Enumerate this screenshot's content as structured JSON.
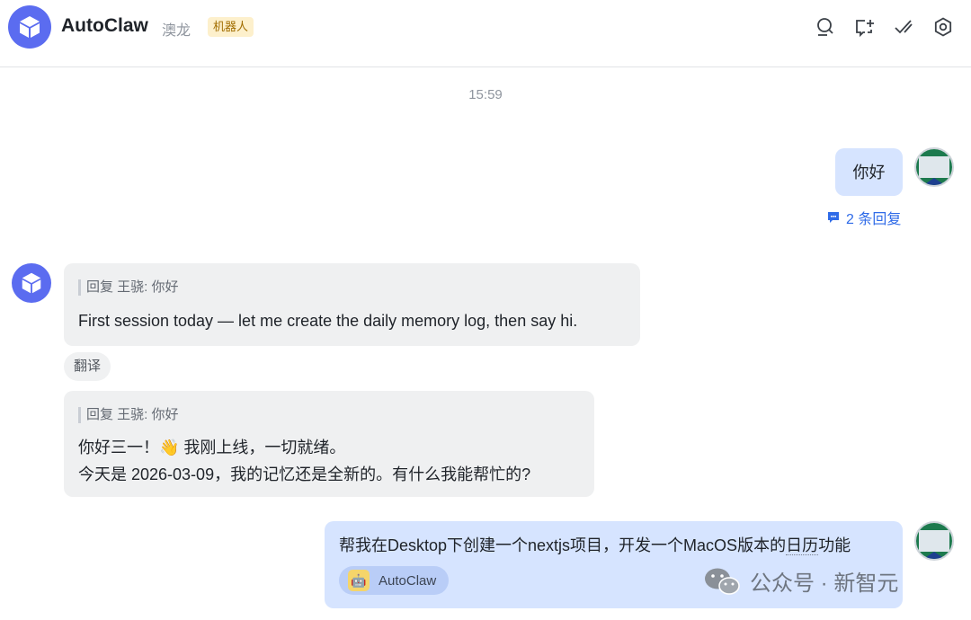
{
  "header": {
    "title": "AutoClaw",
    "subtitle": "澳龙",
    "badge": "机器人",
    "icons": [
      "search-chat-icon",
      "new-chat-icon",
      "check-icon",
      "settings-icon"
    ]
  },
  "chat": {
    "timestamp": "15:59",
    "messages": [
      {
        "role": "user",
        "text": "你好",
        "thread_link": "2 条回复"
      },
      {
        "role": "bot",
        "reply_quote": "回复 王骁: 你好",
        "text": "First session today — let me create the daily memory log, then say hi.",
        "action": "翻译"
      },
      {
        "role": "bot",
        "reply_quote": "回复 王骁: 你好",
        "lines": [
          "你好三一！👋 我刚上线，一切就绪。",
          "今天是 2026-03-09，我的记忆还是全新的。有什么我能帮忙的?"
        ]
      },
      {
        "role": "user",
        "text_before": "帮我在Desktop下创建一个nextjs项目，开发一个MacOS版本的",
        "text_dotted": "日历",
        "text_after": "功能",
        "mention_emoji": "🤖",
        "mention": "AutoClaw"
      }
    ]
  },
  "watermark": "公众号 · 新智元",
  "colors": {
    "accent": "#5b6cf0",
    "user_bubble": "#d6e4ff",
    "bot_bubble": "#eff0f1",
    "link": "#2f6be8"
  }
}
